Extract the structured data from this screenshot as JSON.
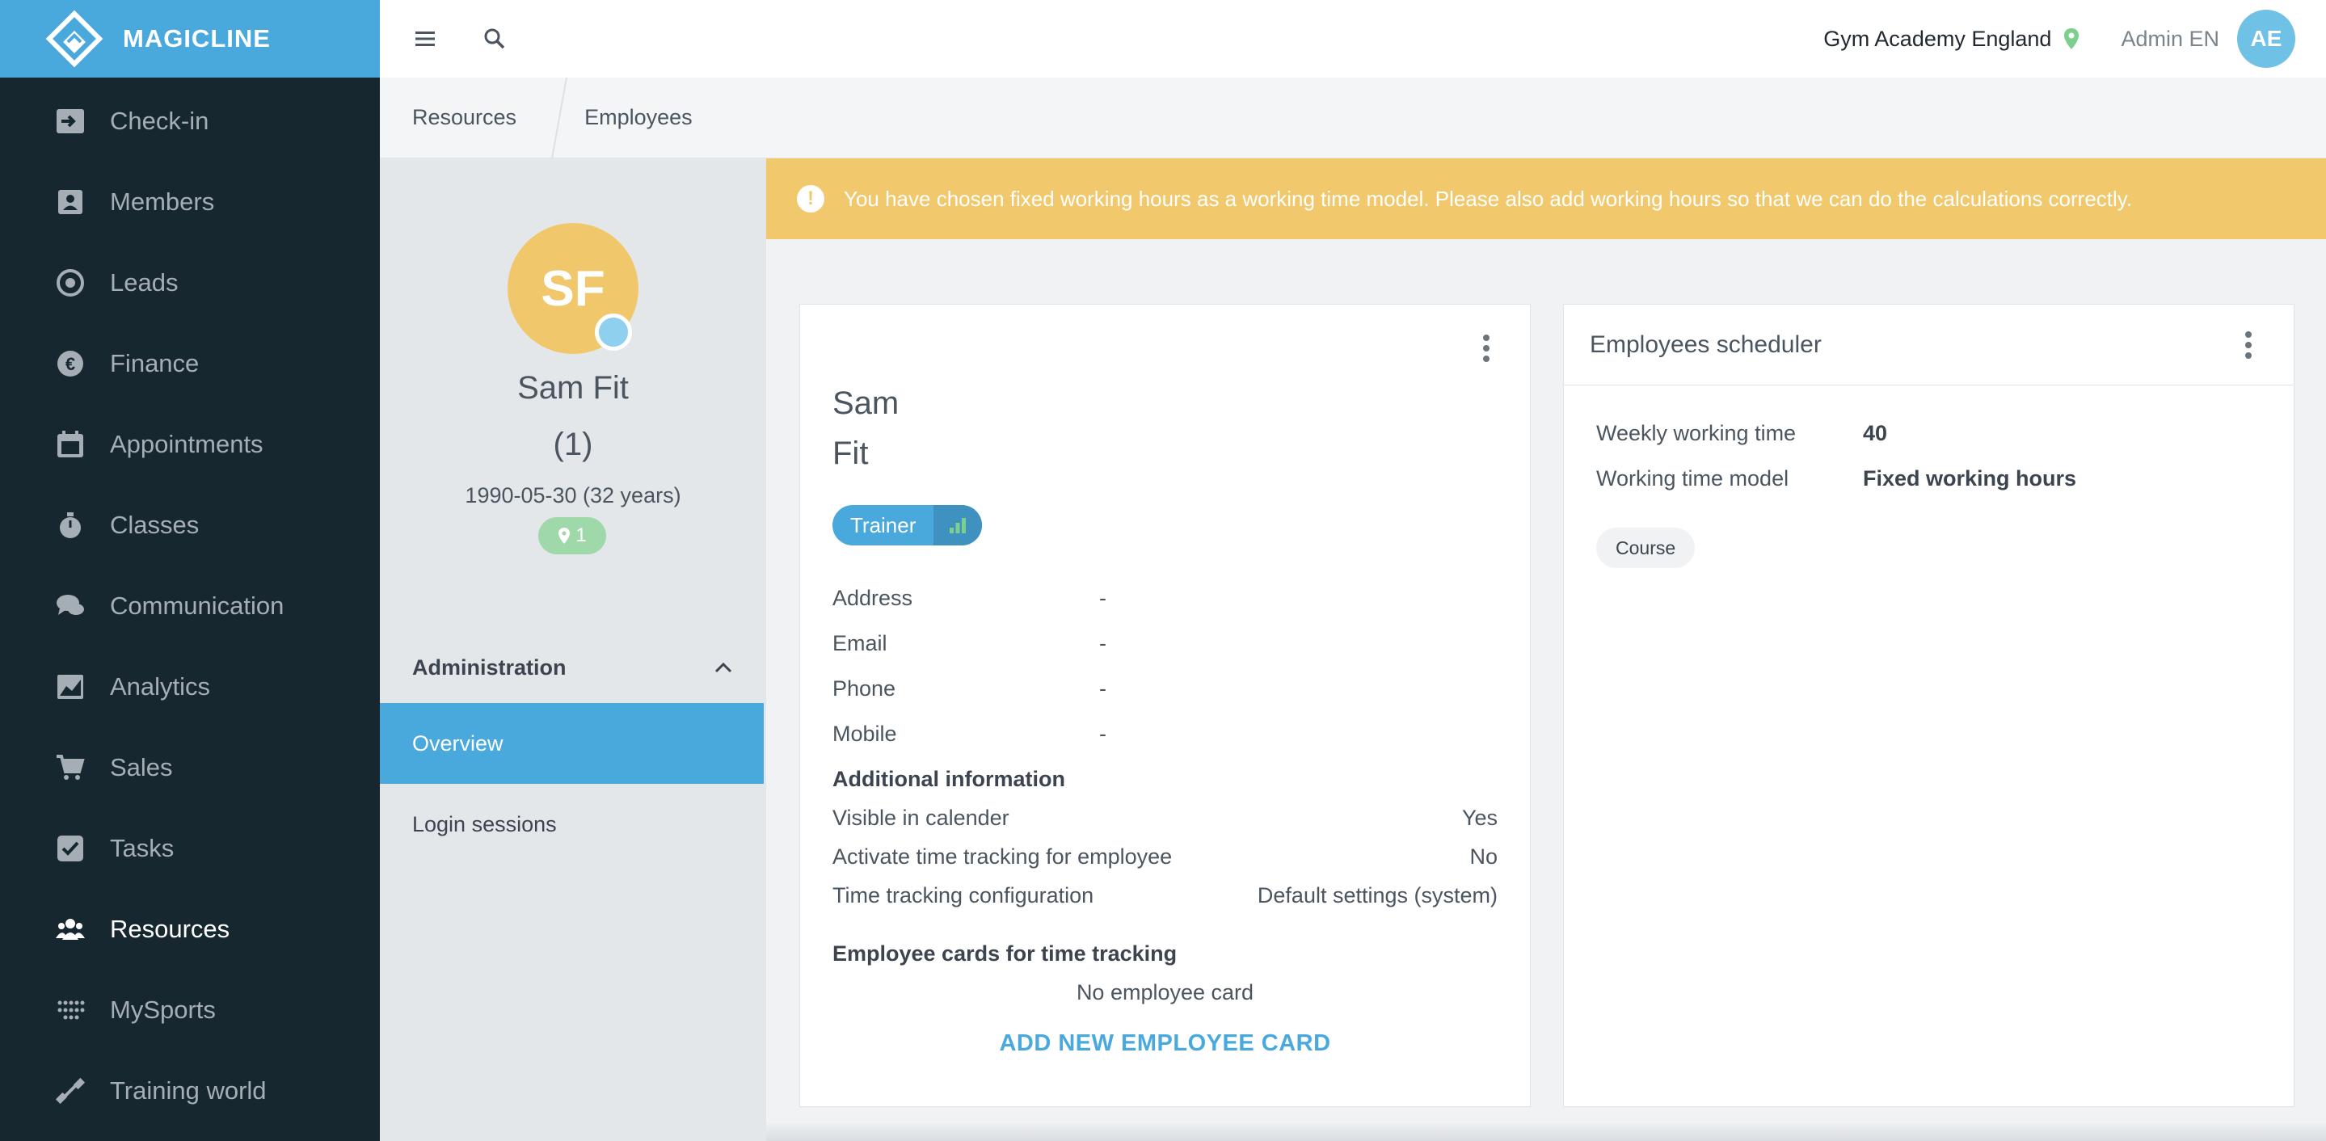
{
  "app": {
    "brand_name": "MAGICLINE"
  },
  "sidebar": {
    "items": [
      {
        "label": "Check-in",
        "icon": "check-in-icon"
      },
      {
        "label": "Members",
        "icon": "members-icon"
      },
      {
        "label": "Leads",
        "icon": "leads-icon"
      },
      {
        "label": "Finance",
        "icon": "finance-icon"
      },
      {
        "label": "Appointments",
        "icon": "calendar-icon"
      },
      {
        "label": "Classes",
        "icon": "stopwatch-icon"
      },
      {
        "label": "Communication",
        "icon": "chat-icon"
      },
      {
        "label": "Analytics",
        "icon": "chart-icon"
      },
      {
        "label": "Sales",
        "icon": "cart-icon"
      },
      {
        "label": "Tasks",
        "icon": "checkbox-icon"
      },
      {
        "label": "Resources",
        "icon": "people-icon",
        "active": true
      },
      {
        "label": "MySports",
        "icon": "dots-icon"
      },
      {
        "label": "Training world",
        "icon": "dumbbell-icon"
      }
    ]
  },
  "topbar": {
    "studio": "Gym Academy England",
    "admin": "Admin EN",
    "avatar_initials": "AE"
  },
  "breadcrumb": {
    "items": [
      "Resources",
      "Employees"
    ]
  },
  "profile": {
    "initials": "SF",
    "name": "Sam Fit",
    "id_label": "(1)",
    "dob": "1990-05-30 (32 years)",
    "location_count": "1",
    "section_label": "Administration",
    "menu": [
      {
        "label": "Overview",
        "active": true
      },
      {
        "label": "Login sessions"
      }
    ]
  },
  "warning": {
    "text": "You have chosen fixed working hours as a working time model. Please also add working hours so that we can do the calculations correctly."
  },
  "employee_card": {
    "first_name": "Sam",
    "last_name": "Fit",
    "role": "Trainer",
    "contacts": [
      {
        "label": "Address",
        "value": "-"
      },
      {
        "label": "Email",
        "value": "-"
      },
      {
        "label": "Phone",
        "value": "-"
      },
      {
        "label": "Mobile",
        "value": "-"
      }
    ],
    "additional_heading": "Additional information",
    "additional": [
      {
        "label": "Visible in calender",
        "value": "Yes"
      },
      {
        "label": "Activate time tracking for employee",
        "value": "No"
      },
      {
        "label": "Time tracking configuration",
        "value": "Default settings (system)"
      }
    ],
    "cards_heading": "Employee cards for time tracking",
    "no_card_text": "No employee card",
    "add_card_label": "ADD NEW EMPLOYEE CARD"
  },
  "scheduler": {
    "title": "Employees scheduler",
    "rows": [
      {
        "label": "Weekly working time",
        "value": "40"
      },
      {
        "label": "Working time model",
        "value": "Fixed working hours"
      }
    ],
    "tag": "Course"
  },
  "colors": {
    "brand": "#49a9dd",
    "sidebar": "#172730",
    "warning": "#f1c96c",
    "avatar": "#f1c76b"
  }
}
